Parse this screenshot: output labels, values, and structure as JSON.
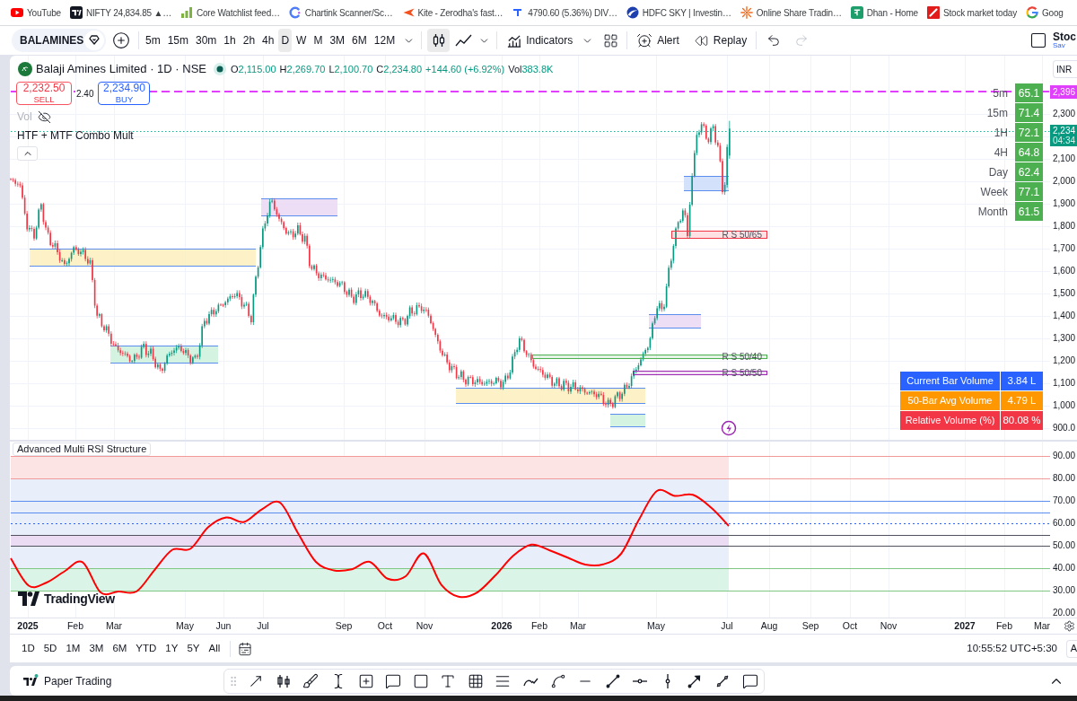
{
  "bookmarks": [
    {
      "label": "YouTube"
    },
    {
      "label": "NIFTY 24,834.85 ▲…"
    },
    {
      "label": "Core Watchlist feed…"
    },
    {
      "label": "Chartink Scanner/Sc…"
    },
    {
      "label": "Kite - Zerodha's fast…"
    },
    {
      "label": "4790.60 (5.36%) DIV…"
    },
    {
      "label": "HDFC SKY | Investin…"
    },
    {
      "label": "Online Share Tradin…"
    },
    {
      "label": "Dhan - Home"
    },
    {
      "label": "Stock market today"
    },
    {
      "label": "Goog"
    }
  ],
  "toolbar": {
    "symbol": "BALAMINES",
    "timeframes": [
      {
        "label": "5m",
        "selected": false
      },
      {
        "label": "15m",
        "selected": false
      },
      {
        "label": "30m",
        "selected": false
      },
      {
        "label": "1h",
        "selected": false
      },
      {
        "label": "2h",
        "selected": false
      },
      {
        "label": "4h",
        "selected": false
      },
      {
        "label": "D",
        "selected": true
      },
      {
        "label": "W",
        "selected": false
      },
      {
        "label": "M",
        "selected": false
      },
      {
        "label": "3M",
        "selected": false
      },
      {
        "label": "6M",
        "selected": false
      },
      {
        "label": "12M",
        "selected": false
      }
    ],
    "chart_types": [
      {
        "selected": true
      },
      {
        "selected": false
      }
    ],
    "indicators": "Indicators",
    "alert": "Alert",
    "replay": "Replay",
    "undo": {
      "disabled": false
    },
    "redo": {
      "disabled": true
    },
    "edge_button": {
      "title": "Stoc",
      "subtitle": "Sav"
    }
  },
  "legend": {
    "title": "Balaji Amines Limited · 1D · NSE",
    "ohlc": [
      {
        "label": "O",
        "value": "2,115.00"
      },
      {
        "label": "H",
        "value": "2,269.70"
      },
      {
        "label": "L",
        "value": "2,100.70"
      },
      {
        "label": "C",
        "value": "2,234.80"
      }
    ],
    "change": "+144.60 (+6.92%)",
    "volume": {
      "label": "Vol",
      "value": "383.8K"
    }
  },
  "trade": {
    "sell": {
      "price": "2,232.50",
      "label": "SELL"
    },
    "spread": "2.40",
    "buy": {
      "price": "2,234.90",
      "label": "BUY"
    }
  },
  "volume_study": {
    "label": "Vol",
    "hidden": true
  },
  "study_label": "HTF + MTF Combo Mult",
  "mtf_rsi_table": [
    {
      "label": "5m",
      "value": "65.1"
    },
    {
      "label": "15m",
      "value": "71.4"
    },
    {
      "label": "1H",
      "value": "72.1"
    },
    {
      "label": "4H",
      "value": "64.8"
    },
    {
      "label": "Day",
      "value": "62.4"
    },
    {
      "label": "Week",
      "value": "77.1"
    },
    {
      "label": "Month",
      "value": "61.5"
    }
  ],
  "levels": [
    {
      "label": "R S 50/65",
      "color": "#f23645"
    },
    {
      "label": "R S 50/40",
      "color": "#4caf50"
    },
    {
      "label": "R S 50/50",
      "color": "#9c27b0"
    }
  ],
  "volume_table": [
    {
      "label": "Current Bar Volume",
      "value": "3.84 L",
      "color": "#2962ff"
    },
    {
      "label": "50-Bar Avg Volume",
      "value": "4.79 L",
      "color": "#ff9800"
    },
    {
      "label": "Relative Volume (%)",
      "value": "80.08 %",
      "color": "#f23645"
    }
  ],
  "price_axis": {
    "currency": "INR",
    "alert_price": "2,396",
    "last_price": "2,234",
    "countdown": "04:34",
    "labels": [
      "2,300",
      "2,100",
      "2,000",
      "1,900",
      "1,800",
      "1,700",
      "1,600",
      "1,500",
      "1,400",
      "1,300",
      "1,200",
      "1,100",
      "1,000",
      "900.0"
    ]
  },
  "rsi_pane": {
    "title": "Advanced Multi RSI Structure",
    "chart_data": {
      "type": "line",
      "grid": true,
      "series": [
        {
          "color": "#ff0000",
          "values": [
            44.4,
            32.2,
            33.6,
            38.6,
            42.7,
            29.2,
            29.6,
            29.6,
            39.1,
            48.2,
            48.6,
            58.3,
            62.6,
            60.6,
            66.3,
            69.2,
            55.6,
            42.8,
            39.0,
            39.5,
            42.8,
            35.3,
            36.4,
            46.6,
            32.5,
            27.2,
            29.3,
            36.8,
            45.6,
            50.5,
            48.0,
            44.8,
            41.6,
            41.7,
            46.4,
            61.7,
            74.4,
            72.2,
            72.7,
            67.1,
            58.8
          ]
        }
      ],
      "ylim": [
        18,
        96.4
      ],
      "yticks": [
        {
          "value": 90,
          "label": "90.00"
        },
        {
          "value": 80,
          "label": "80.00"
        },
        {
          "value": 70,
          "label": "70.00"
        },
        {
          "value": 60,
          "label": "60.00"
        },
        {
          "value": 50,
          "label": "50.00"
        },
        {
          "value": 40,
          "label": "40.00"
        },
        {
          "value": 30,
          "label": "30.00"
        },
        {
          "value": 20,
          "label": "20.00"
        }
      ],
      "bands": [
        {
          "axis": "y",
          "from": 80,
          "to": 90,
          "color": "#fde4e4"
        },
        {
          "axis": "y",
          "from": 40,
          "to": 80,
          "color": "#e9eefb"
        },
        {
          "axis": "y",
          "from": 50,
          "to": 55,
          "color": "#ebdcf3"
        },
        {
          "axis": "y",
          "from": 30,
          "to": 40,
          "color": "#daf5e7"
        }
      ],
      "ref_lines": [
        {
          "axis": "y",
          "value": 90,
          "color": "#f29a9a"
        },
        {
          "axis": "y",
          "value": 80,
          "color": "#f29a9a"
        },
        {
          "axis": "y",
          "value": 70,
          "color": "#5b8def"
        },
        {
          "axis": "y",
          "value": 65,
          "color": "#5b8def"
        },
        {
          "axis": "y",
          "value": 60,
          "color": "#2962ff"
        },
        {
          "axis": "y",
          "value": 55,
          "color": "#50535e"
        },
        {
          "axis": "y",
          "value": 50,
          "color": "#50535e"
        },
        {
          "axis": "y",
          "value": 40,
          "color": "#81c784"
        },
        {
          "axis": "y",
          "value": 30,
          "color": "#81c784"
        }
      ]
    }
  },
  "attribution": "TradingView",
  "time_axis": [
    {
      "label": "2025",
      "kind": "year"
    },
    {
      "label": "Feb",
      "kind": "month"
    },
    {
      "label": "Mar",
      "kind": "month"
    },
    {
      "label": "May",
      "kind": "month"
    },
    {
      "label": "Jun",
      "kind": "month"
    },
    {
      "label": "Jul",
      "kind": "month"
    },
    {
      "label": "Sep",
      "kind": "month"
    },
    {
      "label": "Oct",
      "kind": "month"
    },
    {
      "label": "Nov",
      "kind": "month"
    },
    {
      "label": "2026",
      "kind": "year"
    },
    {
      "label": "Feb",
      "kind": "month"
    },
    {
      "label": "Mar",
      "kind": "month"
    },
    {
      "label": "May",
      "kind": "month"
    },
    {
      "label": "Jul",
      "kind": "month"
    },
    {
      "label": "Aug",
      "kind": "month"
    },
    {
      "label": "Sep",
      "kind": "month"
    },
    {
      "label": "Oct",
      "kind": "month"
    },
    {
      "label": "Nov",
      "kind": "month"
    },
    {
      "label": "2027",
      "kind": "year"
    },
    {
      "label": "Feb",
      "kind": "month"
    },
    {
      "label": "Mar",
      "kind": "month"
    }
  ],
  "ranges": [
    "1D",
    "5D",
    "1M",
    "3M",
    "6M",
    "YTD",
    "1Y",
    "5Y",
    "All"
  ],
  "clock": "10:55:52 UTC+5:30",
  "corner_button": "A",
  "bottom_bar": {
    "title": "Paper Trading"
  }
}
